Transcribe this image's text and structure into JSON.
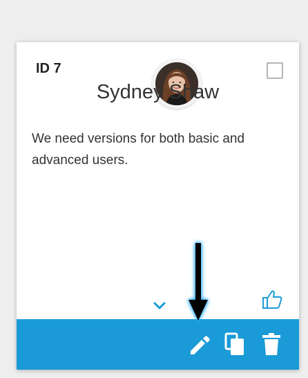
{
  "card": {
    "id_label": "ID 7",
    "name": "Sydney Shaw",
    "description": "We need versions for both basic and advanced users.",
    "avatar": "user-avatar-photo"
  },
  "icons": {
    "checkbox": "checkbox-icon",
    "expand": "chevron-down-icon",
    "like": "thumbs-up-icon",
    "edit": "pencil-icon",
    "copy": "copy-icon",
    "delete": "trash-icon",
    "pointer": "arrow-down-icon"
  },
  "colors": {
    "action_bar": "#1a9bd7",
    "accent_icon": "#1a9bd7",
    "page_background": "#eeeeee",
    "card_background": "#ffffff",
    "arrow": "#000000",
    "arrow_glow": "#27a7ff"
  }
}
